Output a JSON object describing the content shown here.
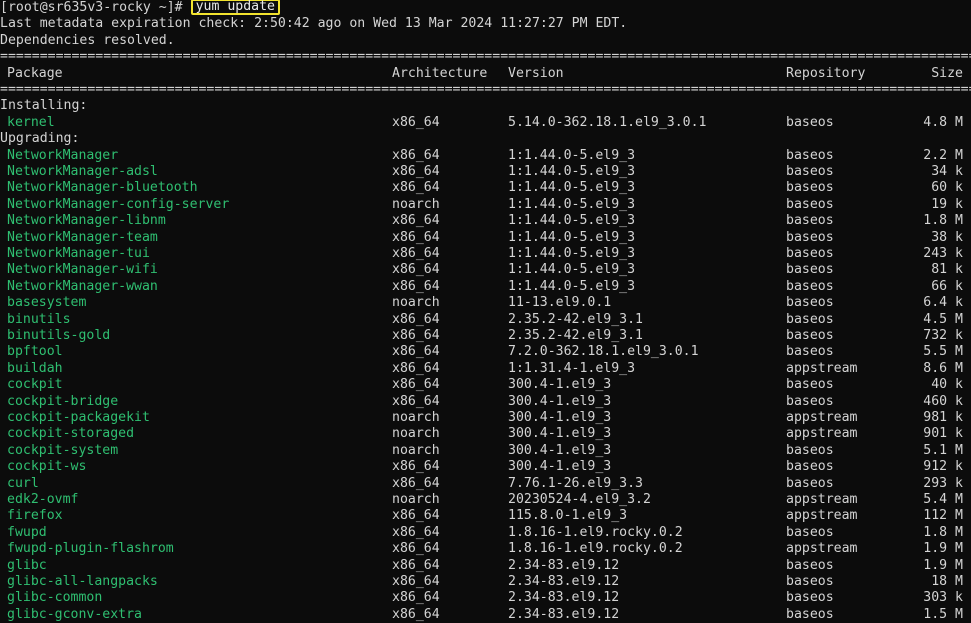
{
  "terminal": {
    "prompt": "[root@sr635v3-rocky ~]# ",
    "command": "yum update",
    "metadata_line": "Last metadata expiration check: 2:50:42 ago on Wed 13 Mar 2024 11:27:27 PM EDT.",
    "deps_line": "Dependencies resolved.",
    "separator_char": "=",
    "columns": {
      "package": "Package",
      "arch": "Architecture",
      "version": "Version",
      "repo": "Repository",
      "size": "Size"
    },
    "section_installing": "Installing:",
    "section_upgrading": "Upgrading:",
    "installing": [
      {
        "name": "kernel",
        "arch": "x86_64",
        "version": "5.14.0-362.18.1.el9_3.0.1",
        "repo": "baseos",
        "size": "4.8 M"
      }
    ],
    "upgrading": [
      {
        "name": "NetworkManager",
        "arch": "x86_64",
        "version": "1:1.44.0-5.el9_3",
        "repo": "baseos",
        "size": "2.2 M"
      },
      {
        "name": "NetworkManager-adsl",
        "arch": "x86_64",
        "version": "1:1.44.0-5.el9_3",
        "repo": "baseos",
        "size": "34 k"
      },
      {
        "name": "NetworkManager-bluetooth",
        "arch": "x86_64",
        "version": "1:1.44.0-5.el9_3",
        "repo": "baseos",
        "size": "60 k"
      },
      {
        "name": "NetworkManager-config-server",
        "arch": "noarch",
        "version": "1:1.44.0-5.el9_3",
        "repo": "baseos",
        "size": "19 k"
      },
      {
        "name": "NetworkManager-libnm",
        "arch": "x86_64",
        "version": "1:1.44.0-5.el9_3",
        "repo": "baseos",
        "size": "1.8 M"
      },
      {
        "name": "NetworkManager-team",
        "arch": "x86_64",
        "version": "1:1.44.0-5.el9_3",
        "repo": "baseos",
        "size": "38 k"
      },
      {
        "name": "NetworkManager-tui",
        "arch": "x86_64",
        "version": "1:1.44.0-5.el9_3",
        "repo": "baseos",
        "size": "243 k"
      },
      {
        "name": "NetworkManager-wifi",
        "arch": "x86_64",
        "version": "1:1.44.0-5.el9_3",
        "repo": "baseos",
        "size": "81 k"
      },
      {
        "name": "NetworkManager-wwan",
        "arch": "x86_64",
        "version": "1:1.44.0-5.el9_3",
        "repo": "baseos",
        "size": "66 k"
      },
      {
        "name": "basesystem",
        "arch": "noarch",
        "version": "11-13.el9.0.1",
        "repo": "baseos",
        "size": "6.4 k"
      },
      {
        "name": "binutils",
        "arch": "x86_64",
        "version": "2.35.2-42.el9_3.1",
        "repo": "baseos",
        "size": "4.5 M"
      },
      {
        "name": "binutils-gold",
        "arch": "x86_64",
        "version": "2.35.2-42.el9_3.1",
        "repo": "baseos",
        "size": "732 k"
      },
      {
        "name": "bpftool",
        "arch": "x86_64",
        "version": "7.2.0-362.18.1.el9_3.0.1",
        "repo": "baseos",
        "size": "5.5 M"
      },
      {
        "name": "buildah",
        "arch": "x86_64",
        "version": "1:1.31.4-1.el9_3",
        "repo": "appstream",
        "size": "8.6 M"
      },
      {
        "name": "cockpit",
        "arch": "x86_64",
        "version": "300.4-1.el9_3",
        "repo": "baseos",
        "size": "40 k"
      },
      {
        "name": "cockpit-bridge",
        "arch": "x86_64",
        "version": "300.4-1.el9_3",
        "repo": "baseos",
        "size": "460 k"
      },
      {
        "name": "cockpit-packagekit",
        "arch": "noarch",
        "version": "300.4-1.el9_3",
        "repo": "appstream",
        "size": "981 k"
      },
      {
        "name": "cockpit-storaged",
        "arch": "noarch",
        "version": "300.4-1.el9_3",
        "repo": "appstream",
        "size": "901 k"
      },
      {
        "name": "cockpit-system",
        "arch": "noarch",
        "version": "300.4-1.el9_3",
        "repo": "baseos",
        "size": "5.1 M"
      },
      {
        "name": "cockpit-ws",
        "arch": "x86_64",
        "version": "300.4-1.el9_3",
        "repo": "baseos",
        "size": "912 k"
      },
      {
        "name": "curl",
        "arch": "x86_64",
        "version": "7.76.1-26.el9_3.3",
        "repo": "baseos",
        "size": "293 k"
      },
      {
        "name": "edk2-ovmf",
        "arch": "noarch",
        "version": "20230524-4.el9_3.2",
        "repo": "appstream",
        "size": "5.4 M"
      },
      {
        "name": "firefox",
        "arch": "x86_64",
        "version": "115.8.0-1.el9_3",
        "repo": "appstream",
        "size": "112 M"
      },
      {
        "name": "fwupd",
        "arch": "x86_64",
        "version": "1.8.16-1.el9.rocky.0.2",
        "repo": "baseos",
        "size": "1.8 M"
      },
      {
        "name": "fwupd-plugin-flashrom",
        "arch": "x86_64",
        "version": "1.8.16-1.el9.rocky.0.2",
        "repo": "appstream",
        "size": "1.9 M"
      },
      {
        "name": "glibc",
        "arch": "x86_64",
        "version": "2.34-83.el9.12",
        "repo": "baseos",
        "size": "1.9 M"
      },
      {
        "name": "glibc-all-langpacks",
        "arch": "x86_64",
        "version": "2.34-83.el9.12",
        "repo": "baseos",
        "size": "18 M"
      },
      {
        "name": "glibc-common",
        "arch": "x86_64",
        "version": "2.34-83.el9.12",
        "repo": "baseos",
        "size": "303 k"
      },
      {
        "name": "glibc-gconv-extra",
        "arch": "x86_64",
        "version": "2.34-83.el9.12",
        "repo": "baseos",
        "size": "1.5 M"
      }
    ]
  },
  "colors": {
    "background": "#0c0c0c",
    "text": "#d4d4d4",
    "package_name": "#2fbf71",
    "command_highlight": "#f2e32e"
  }
}
